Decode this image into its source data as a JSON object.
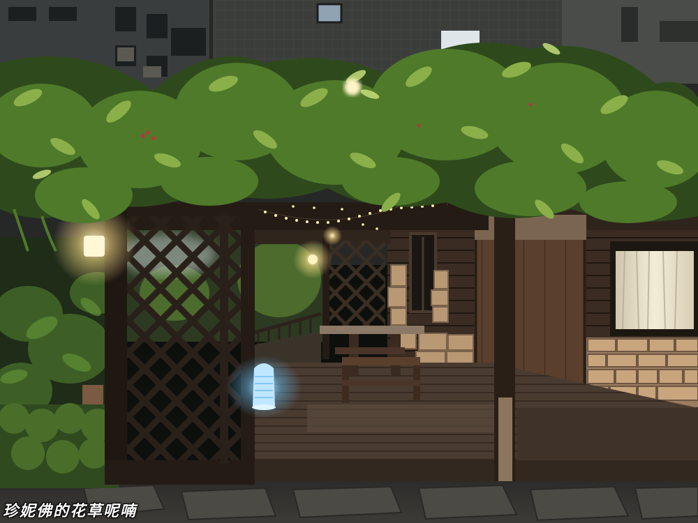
{
  "watermark": {
    "text": "珍妮佛的花草呢喃"
  },
  "colors": {
    "night_sky": "#2a2c2b",
    "foliage": "#4f7a2a",
    "foliage_highlight": "#9fc25a",
    "wood_deck": "#4a3a2e",
    "lattice": "#2a201a",
    "cabin_door": "#5a3f2c",
    "stone_wall": "#b99874",
    "lamp_glow": "#fff4c8",
    "mosquito_lamp": "#7fd0ff"
  },
  "icons": [
    "string-lights",
    "lantern-icon",
    "bug-zapper-icon"
  ]
}
